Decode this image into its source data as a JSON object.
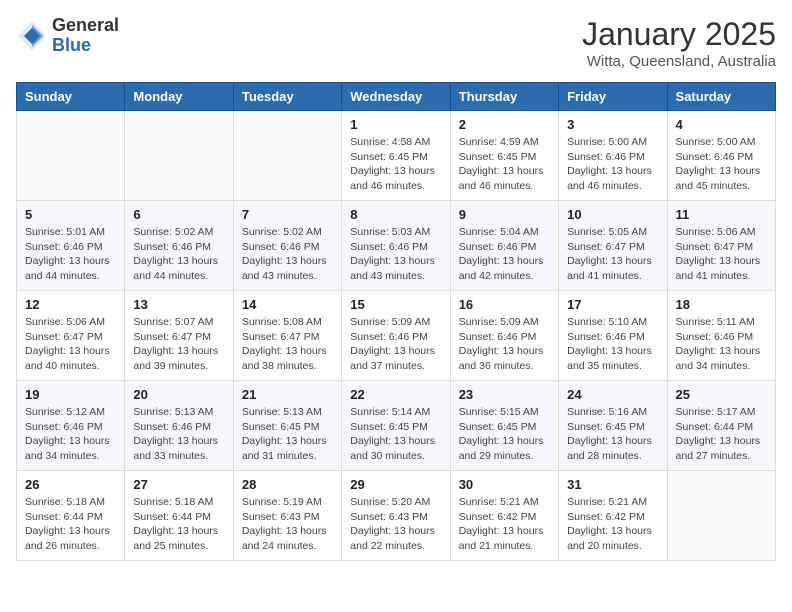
{
  "header": {
    "logo_general": "General",
    "logo_blue": "Blue",
    "month": "January 2025",
    "location": "Witta, Queensland, Australia"
  },
  "days_of_week": [
    "Sunday",
    "Monday",
    "Tuesday",
    "Wednesday",
    "Thursday",
    "Friday",
    "Saturday"
  ],
  "weeks": [
    [
      {
        "day": "",
        "info": ""
      },
      {
        "day": "",
        "info": ""
      },
      {
        "day": "",
        "info": ""
      },
      {
        "day": "1",
        "info": "Sunrise: 4:58 AM\nSunset: 6:45 PM\nDaylight: 13 hours\nand 46 minutes."
      },
      {
        "day": "2",
        "info": "Sunrise: 4:59 AM\nSunset: 6:45 PM\nDaylight: 13 hours\nand 46 minutes."
      },
      {
        "day": "3",
        "info": "Sunrise: 5:00 AM\nSunset: 6:46 PM\nDaylight: 13 hours\nand 46 minutes."
      },
      {
        "day": "4",
        "info": "Sunrise: 5:00 AM\nSunset: 6:46 PM\nDaylight: 13 hours\nand 45 minutes."
      }
    ],
    [
      {
        "day": "5",
        "info": "Sunrise: 5:01 AM\nSunset: 6:46 PM\nDaylight: 13 hours\nand 44 minutes."
      },
      {
        "day": "6",
        "info": "Sunrise: 5:02 AM\nSunset: 6:46 PM\nDaylight: 13 hours\nand 44 minutes."
      },
      {
        "day": "7",
        "info": "Sunrise: 5:02 AM\nSunset: 6:46 PM\nDaylight: 13 hours\nand 43 minutes."
      },
      {
        "day": "8",
        "info": "Sunrise: 5:03 AM\nSunset: 6:46 PM\nDaylight: 13 hours\nand 43 minutes."
      },
      {
        "day": "9",
        "info": "Sunrise: 5:04 AM\nSunset: 6:46 PM\nDaylight: 13 hours\nand 42 minutes."
      },
      {
        "day": "10",
        "info": "Sunrise: 5:05 AM\nSunset: 6:47 PM\nDaylight: 13 hours\nand 41 minutes."
      },
      {
        "day": "11",
        "info": "Sunrise: 5:06 AM\nSunset: 6:47 PM\nDaylight: 13 hours\nand 41 minutes."
      }
    ],
    [
      {
        "day": "12",
        "info": "Sunrise: 5:06 AM\nSunset: 6:47 PM\nDaylight: 13 hours\nand 40 minutes."
      },
      {
        "day": "13",
        "info": "Sunrise: 5:07 AM\nSunset: 6:47 PM\nDaylight: 13 hours\nand 39 minutes."
      },
      {
        "day": "14",
        "info": "Sunrise: 5:08 AM\nSunset: 6:47 PM\nDaylight: 13 hours\nand 38 minutes."
      },
      {
        "day": "15",
        "info": "Sunrise: 5:09 AM\nSunset: 6:46 PM\nDaylight: 13 hours\nand 37 minutes."
      },
      {
        "day": "16",
        "info": "Sunrise: 5:09 AM\nSunset: 6:46 PM\nDaylight: 13 hours\nand 36 minutes."
      },
      {
        "day": "17",
        "info": "Sunrise: 5:10 AM\nSunset: 6:46 PM\nDaylight: 13 hours\nand 35 minutes."
      },
      {
        "day": "18",
        "info": "Sunrise: 5:11 AM\nSunset: 6:46 PM\nDaylight: 13 hours\nand 34 minutes."
      }
    ],
    [
      {
        "day": "19",
        "info": "Sunrise: 5:12 AM\nSunset: 6:46 PM\nDaylight: 13 hours\nand 34 minutes."
      },
      {
        "day": "20",
        "info": "Sunrise: 5:13 AM\nSunset: 6:46 PM\nDaylight: 13 hours\nand 33 minutes."
      },
      {
        "day": "21",
        "info": "Sunrise: 5:13 AM\nSunset: 6:45 PM\nDaylight: 13 hours\nand 31 minutes."
      },
      {
        "day": "22",
        "info": "Sunrise: 5:14 AM\nSunset: 6:45 PM\nDaylight: 13 hours\nand 30 minutes."
      },
      {
        "day": "23",
        "info": "Sunrise: 5:15 AM\nSunset: 6:45 PM\nDaylight: 13 hours\nand 29 minutes."
      },
      {
        "day": "24",
        "info": "Sunrise: 5:16 AM\nSunset: 6:45 PM\nDaylight: 13 hours\nand 28 minutes."
      },
      {
        "day": "25",
        "info": "Sunrise: 5:17 AM\nSunset: 6:44 PM\nDaylight: 13 hours\nand 27 minutes."
      }
    ],
    [
      {
        "day": "26",
        "info": "Sunrise: 5:18 AM\nSunset: 6:44 PM\nDaylight: 13 hours\nand 26 minutes."
      },
      {
        "day": "27",
        "info": "Sunrise: 5:18 AM\nSunset: 6:44 PM\nDaylight: 13 hours\nand 25 minutes."
      },
      {
        "day": "28",
        "info": "Sunrise: 5:19 AM\nSunset: 6:43 PM\nDaylight: 13 hours\nand 24 minutes."
      },
      {
        "day": "29",
        "info": "Sunrise: 5:20 AM\nSunset: 6:43 PM\nDaylight: 13 hours\nand 22 minutes."
      },
      {
        "day": "30",
        "info": "Sunrise: 5:21 AM\nSunset: 6:42 PM\nDaylight: 13 hours\nand 21 minutes."
      },
      {
        "day": "31",
        "info": "Sunrise: 5:21 AM\nSunset: 6:42 PM\nDaylight: 13 hours\nand 20 minutes."
      },
      {
        "day": "",
        "info": ""
      }
    ]
  ]
}
